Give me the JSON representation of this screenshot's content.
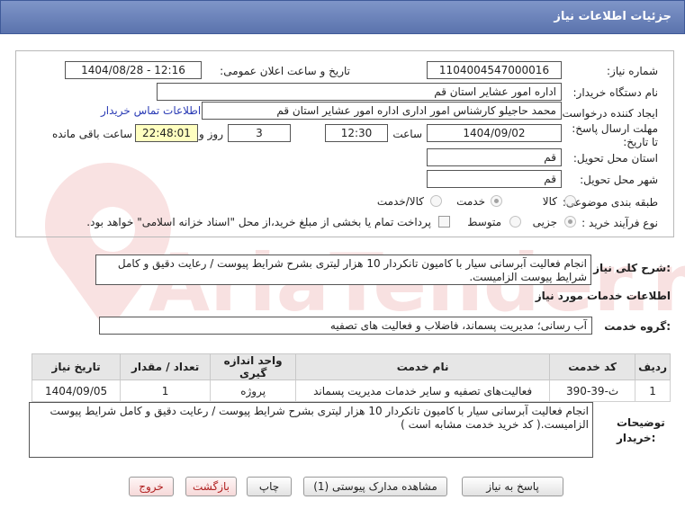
{
  "window": {
    "title": "جزئیات اطلاعات نیاز"
  },
  "form": {
    "need_number_label": "شماره نیاز:",
    "need_number": "1104004547000016",
    "announce_label": "تاریخ و ساعت اعلان عمومی:",
    "announce_value": "1404/08/28 - 12:16",
    "buyer_org_label": "نام دستگاه خریدار:",
    "buyer_org": "اداره امور عشایر استان قم",
    "creator_label": "ایجاد کننده درخواست:",
    "creator": "محمد حاجیلو کارشناس امور اداری اداره امور عشایر استان قم",
    "contact_link": "اطلاعات تماس خریدار",
    "deadline_label": "مهلت ارسال پاسخ: تا تاریخ:",
    "deadline_date": "1404/09/02",
    "time_label": "ساعت",
    "deadline_time": "12:30",
    "days_value": "3",
    "days_label": "روز و",
    "remaining_time": "22:48:01",
    "remaining_label": "ساعت باقی مانده",
    "province_label": "استان محل تحویل:",
    "province": "قم",
    "city_label": "شهر محل تحویل:",
    "city": "قم",
    "category_label": "طبقه بندی موضوعی:",
    "category_options": [
      "کالا",
      "خدمت",
      "کالا/خدمت"
    ],
    "category_selected": "خدمت",
    "process_label": "نوع فرآیند خرید :",
    "process_options": [
      "جزیی",
      "متوسط"
    ],
    "process_selected": "جزیی",
    "payment_note": "پرداخت تمام یا بخشی از مبلغ خرید،از محل \"اسناد خزانه اسلامی\" خواهد بود."
  },
  "summary": {
    "label": "شرح کلی نیاز:",
    "text": "انجام فعالیت آبرسانی سیار با کامیون تانکردار 10 هزار لیتری  بشرح شرایط پیوست / رعایت دقیق و کامل شرایط پیوست الزامیست."
  },
  "services_title": "اطلاعات خدمات مورد نیاز",
  "service_group": {
    "label": "گروه خدمت:",
    "value": "آب رسانی؛ مدیریت پسماند، فاضلاب و فعالیت های تصفیه"
  },
  "table": {
    "headers": [
      "ردیف",
      "کد خدمت",
      "نام خدمت",
      "واحد اندازه گیری",
      "تعداد / مقدار",
      "تاریخ نیاز"
    ],
    "rows": [
      [
        "1",
        "ث-39-390",
        "فعالیت‌های تصفیه و سایر خدمات مدیریت پسماند",
        "پروژه",
        "1",
        "1404/09/05"
      ]
    ]
  },
  "buyer_notes": {
    "label": "توضیحات خریدار:",
    "text": "انجام فعالیت آبرسانی سیار با کامیون تانکردار 10 هزار لیتری  بشرح شرایط پیوست / رعایت دقیق و کامل شرایط پیوست الزامیست.( کد خرید خدمت مشابه است )"
  },
  "buttons": {
    "reply": "پاسخ به نیاز",
    "attachments": "مشاهده مدارک پیوستی (1)",
    "print": "چاپ",
    "back": "بازگشت",
    "exit": "خروج"
  },
  "watermark": {
    "text": "AriaTender.net"
  },
  "colors": {
    "titlebar": "#6a82bb",
    "highlight": "#ffffc0",
    "link": "#2a3bb5",
    "exit_text": "#b02020"
  }
}
